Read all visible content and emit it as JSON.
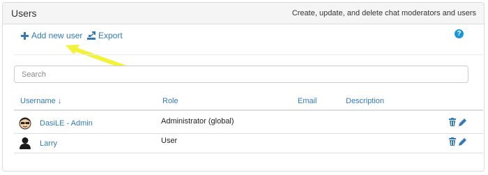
{
  "header": {
    "title": "Users",
    "subtitle": "Create, update, and delete chat moderators and users"
  },
  "toolbar": {
    "add_label": "Add new user",
    "export_label": "Export",
    "help_label": "?"
  },
  "search": {
    "placeholder": "Search",
    "value": ""
  },
  "table": {
    "columns": [
      "Username ↓",
      "Role",
      "Email",
      "Description"
    ],
    "rows": [
      {
        "username": "DasiLE - Admin",
        "role": "Administrator (global)",
        "email": "",
        "description": "",
        "avatar": "admin-avatar-icon"
      },
      {
        "username": "Larry",
        "role": "User",
        "email": "",
        "description": "",
        "avatar": "user-silhouette-icon"
      }
    ]
  },
  "colors": {
    "link": "#337ab7",
    "help": "#1a95d6",
    "annotation_arrow": "#f2f23a"
  }
}
